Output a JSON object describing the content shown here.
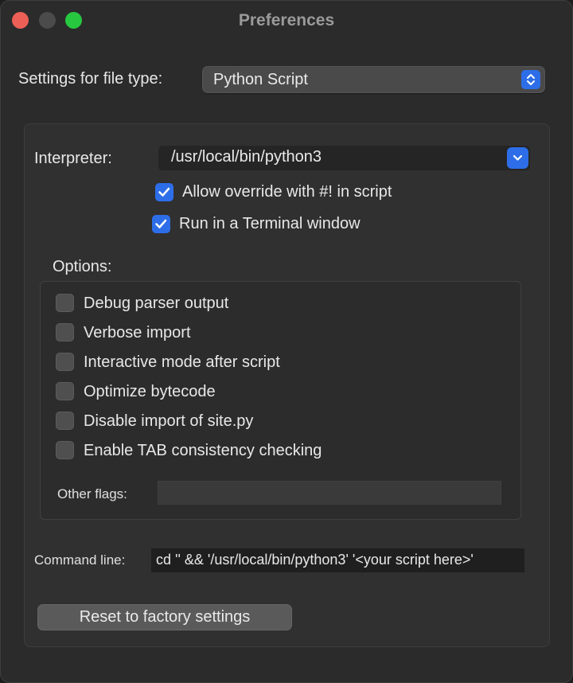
{
  "window": {
    "title": "Preferences"
  },
  "file_type": {
    "label": "Settings for file type:",
    "selected": "Python Script"
  },
  "interpreter": {
    "label": "Interpreter:",
    "value": "/usr/local/bin/python3"
  },
  "checkboxes_top": [
    {
      "label": "Allow override with #! in script",
      "checked": true
    },
    {
      "label": "Run in a Terminal window",
      "checked": true
    }
  ],
  "options": {
    "label": "Options:",
    "items": [
      {
        "label": "Debug parser output",
        "checked": false
      },
      {
        "label": "Verbose import",
        "checked": false
      },
      {
        "label": "Interactive mode after script",
        "checked": false
      },
      {
        "label": "Optimize bytecode",
        "checked": false
      },
      {
        "label": "Disable import of site.py",
        "checked": false
      },
      {
        "label": "Enable TAB consistency checking",
        "checked": false
      }
    ],
    "other_flags_label": "Other flags:",
    "other_flags_value": ""
  },
  "command_line": {
    "label": "Command line:",
    "value": "cd '' && '/usr/local/bin/python3'  '<your script here>'"
  },
  "reset_button": "Reset to factory settings",
  "colors": {
    "accent": "#2d6ee8",
    "close": "#ec5f57",
    "maximize": "#27c840"
  }
}
